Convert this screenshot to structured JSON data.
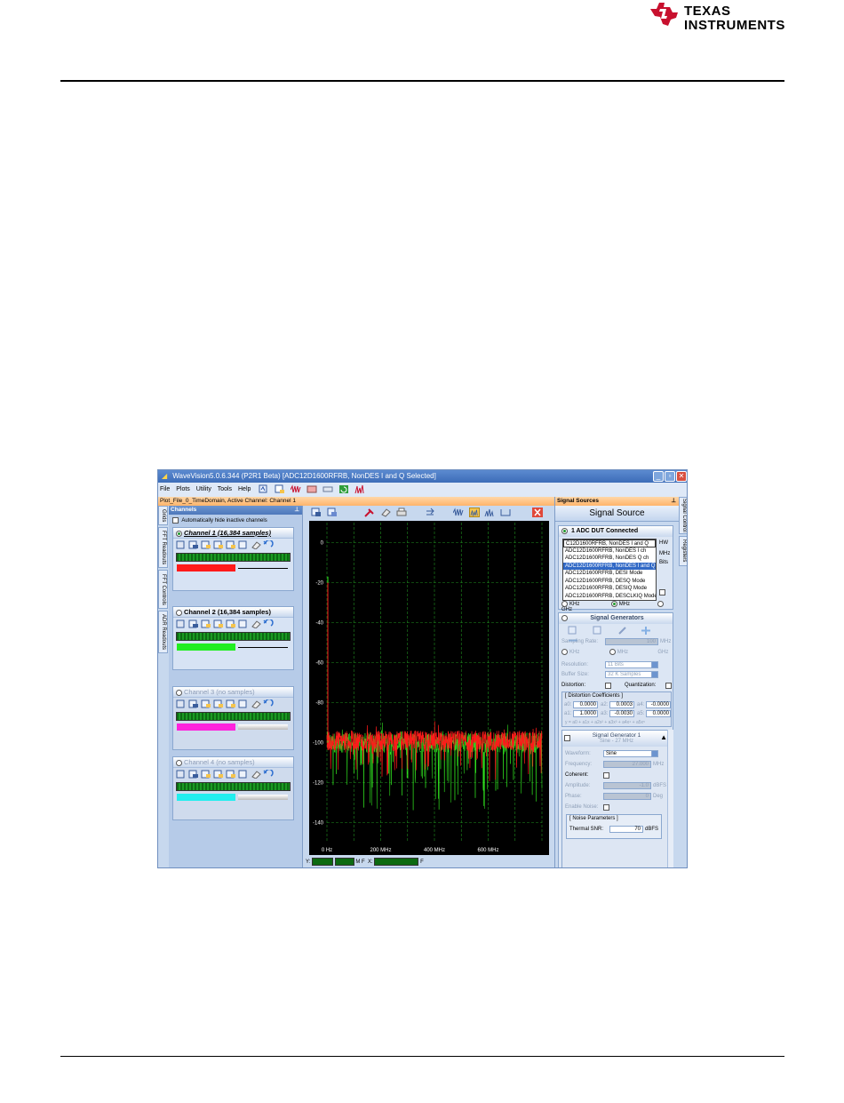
{
  "logo": {
    "line1": "TEXAS",
    "line2": "INSTRUMENTS",
    "accent": "#c8102e"
  },
  "window": {
    "title": "WaveVision5.0.6.344 (P2R1 Beta)  [ADC12D1600RFRB, NonDES I and Q Selected]",
    "min": "_",
    "max": "▫",
    "close": "✕"
  },
  "menu": [
    "File",
    "Plots",
    "Utility",
    "Tools",
    "Help"
  ],
  "status": "Plot_File_0_TimeDomain,  Active Channel: Channel 1",
  "left_tabs": [
    "Grids",
    "FFT Readouts",
    "FFT Controls",
    "ADR Readouts"
  ],
  "channels": {
    "header": "Channels",
    "pin": "⊥",
    "auto_hide": "Automatically hide inactive channels",
    "list": [
      {
        "title": "Channel 1 (16,384 samples)",
        "color": "#ff1a1a",
        "active": true
      },
      {
        "title": "Channel 2 (16,384 samples)",
        "color": "#22ee22",
        "active": false
      },
      {
        "title": "Channel 3 (no samples)",
        "color": "#ff22dd",
        "active": false
      },
      {
        "title": "Channel 4 (no samples)",
        "color": "#22eeee",
        "active": false
      }
    ]
  },
  "plot_bottom": {
    "y_label": "Y:",
    "m_label": "M",
    "f_label": "F",
    "x_label": "X:",
    "f2_label": "F"
  },
  "signal_sources": {
    "header": "Signal Sources",
    "pin": "⊥",
    "title": "Signal Source",
    "adc_section": "1 ADC DUT Connected",
    "dropdown": [
      "C12D1600RFRB, NonDES I and Q",
      "ADC12D1600RFRB, NonDES I ch",
      "ADC12D1600RFRB, NonDES Q ch",
      "ADC12D1600RFRB, NonDES I and Q",
      "ADC12D1600RFRB, DESI Mode",
      "ADC12D1600RFRB, DESQ Mode",
      "ADC12D1600RFRB, DESIQ Mode",
      "ADC12D1600RFRB, DESCLKIQ Mode"
    ],
    "side_units": [
      "HW",
      "MHz",
      "Bits"
    ],
    "freq_units": [
      "KHz",
      "MHz",
      "GHz"
    ],
    "gen_section": "Signal Generators",
    "sampling_rate_label": "Sampling Rate:",
    "sampling_rate_value": "100",
    "sampling_rate_unit": "MHz",
    "sr_units": [
      "KHz",
      "MHz",
      "GHz"
    ],
    "resolution_label": "Resolution:",
    "resolution_value": "11 Bits",
    "buffer_label": "Buffer Size:",
    "buffer_value": "32 K Samples",
    "distortion_label": "Distortion:",
    "quantization_label": "Quantization:",
    "coeff_title": "[ Distortion Coefficients ]",
    "coeffs": [
      {
        "k": "a0:",
        "v": "0.0000"
      },
      {
        "k": "a2:",
        "v": "0.0003"
      },
      {
        "k": "a4:",
        "v": "-0.0000"
      },
      {
        "k": "a1:",
        "v": "1.0000"
      },
      {
        "k": "a3:",
        "v": "-0.0030"
      },
      {
        "k": "a5:",
        "v": "0.0000"
      }
    ],
    "coeff_note": "y = a0 + a1x + a2x² + a3x³ + a4x⁴ + a5x⁵",
    "gen1_title": "Signal Generator 1",
    "gen1_sub": "Sine - 27 MHz",
    "waveform_label": "Waveform:",
    "waveform_value": "Sine",
    "frequency_label": "Frequency:",
    "frequency_value": "27.000",
    "frequency_unit": "MHz",
    "coherent_label": "Coherent:",
    "amplitude_label": "Amplitude:",
    "amplitude_value": "-1.0",
    "amplitude_unit": "dBFS",
    "phase_label": "Phase:",
    "phase_value": "0",
    "phase_unit": "Deg",
    "noise_label": "Enable Noise:",
    "noise_params": "[ Noise Parameters ]",
    "snr_label": "Thermal SNR:",
    "snr_value": "70",
    "snr_unit": "dBFS"
  },
  "right_tabs": [
    "Signal Control",
    "Registers"
  ],
  "chart_data": {
    "type": "line",
    "x_unit": "MHz",
    "xlim": [
      0,
      800
    ],
    "ylim": [
      -150,
      10
    ],
    "x_ticks": [
      0,
      200,
      400,
      600
    ],
    "x_tick_labels": [
      "0 Hz",
      "200 MHz",
      "400 MHz",
      "600 MHz"
    ],
    "y_ticks": [
      0,
      -20,
      -40,
      -60,
      -80,
      -100,
      -120,
      -140
    ],
    "grid": true,
    "background": "#000000",
    "grid_color": "#1f8f1f",
    "series": [
      {
        "color": "#33ee22",
        "noise_floor": -100,
        "spur": {
          "x": 0,
          "y": -17
        }
      },
      {
        "color": "#ff1a1a",
        "noise_floor": -99,
        "spur": {
          "x": 0,
          "y": -20
        }
      }
    ]
  }
}
